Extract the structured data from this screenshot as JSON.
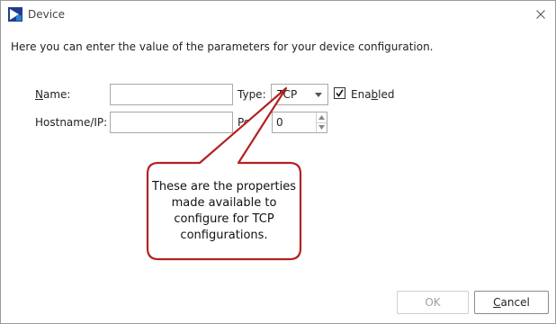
{
  "window": {
    "title": "Device",
    "app_icon": "app-logo-icon",
    "close_icon": "close-icon"
  },
  "form": {
    "description": "Here you can enter the value of the parameters for your device configuration.",
    "name_label_first": "N",
    "name_label_rest": "ame:",
    "name_value": "",
    "type_label": "Type:",
    "type_selected": "TCP",
    "enabled_label_pre": "Ena",
    "enabled_label_u": "b",
    "enabled_label_post": "led",
    "enabled_checked": true,
    "hostname_label": "Hostname/IP:",
    "hostname_value": "",
    "port_label": "Port:",
    "port_value": "0"
  },
  "callout": {
    "text": "These are the properties\nmade available to\nconfigure for TCP\nconfigurations.",
    "border_color": "#b22222"
  },
  "buttons": {
    "ok_label": "OK",
    "cancel_first": "C",
    "cancel_rest": "ancel"
  }
}
